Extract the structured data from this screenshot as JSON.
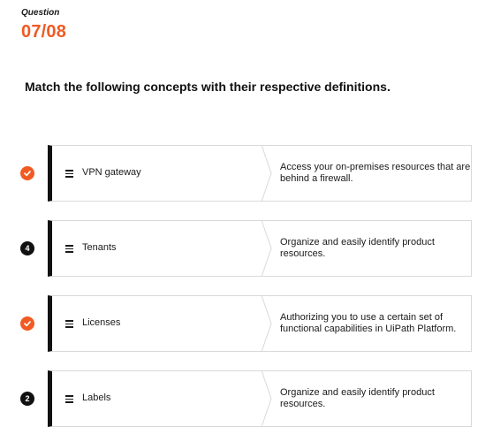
{
  "header": {
    "label": "Question",
    "number": "07/08"
  },
  "prompt": "Match the following concepts with their respective definitions.",
  "rows": [
    {
      "status": "check",
      "badge": "",
      "concept": "VPN gateway",
      "definition": "Access your on-premises resources that are behind a firewall."
    },
    {
      "status": "number",
      "badge": "4",
      "concept": "Tenants",
      "definition": "Organize and easily identify product resources."
    },
    {
      "status": "check",
      "badge": "",
      "concept": "Licenses",
      "definition": "Authorizing you to use a certain set of functional capabilities in UiPath Platform."
    },
    {
      "status": "number",
      "badge": "2",
      "concept": "Labels",
      "definition": "Organize and easily identify product resources."
    }
  ],
  "colors": {
    "accent": "#f15a22",
    "dark": "#111111",
    "border": "#d9d9d9"
  },
  "icons": {
    "check": "checkmark-icon",
    "handle": "drag-handle-icon"
  }
}
